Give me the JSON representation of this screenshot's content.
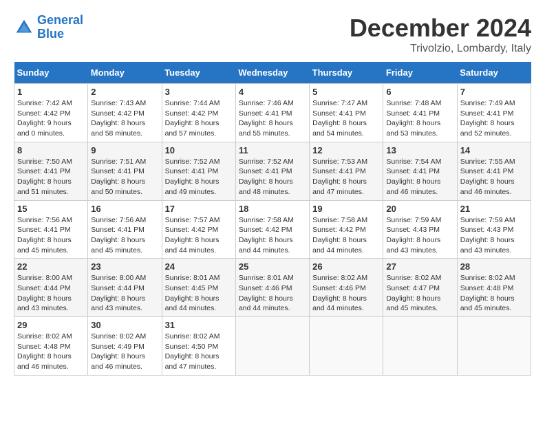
{
  "header": {
    "logo_line1": "General",
    "logo_line2": "Blue",
    "month": "December 2024",
    "location": "Trivolzio, Lombardy, Italy"
  },
  "weekdays": [
    "Sunday",
    "Monday",
    "Tuesday",
    "Wednesday",
    "Thursday",
    "Friday",
    "Saturday"
  ],
  "weeks": [
    [
      {
        "day": "1",
        "info": "Sunrise: 7:42 AM\nSunset: 4:42 PM\nDaylight: 9 hours\nand 0 minutes."
      },
      {
        "day": "2",
        "info": "Sunrise: 7:43 AM\nSunset: 4:42 PM\nDaylight: 8 hours\nand 58 minutes."
      },
      {
        "day": "3",
        "info": "Sunrise: 7:44 AM\nSunset: 4:42 PM\nDaylight: 8 hours\nand 57 minutes."
      },
      {
        "day": "4",
        "info": "Sunrise: 7:46 AM\nSunset: 4:41 PM\nDaylight: 8 hours\nand 55 minutes."
      },
      {
        "day": "5",
        "info": "Sunrise: 7:47 AM\nSunset: 4:41 PM\nDaylight: 8 hours\nand 54 minutes."
      },
      {
        "day": "6",
        "info": "Sunrise: 7:48 AM\nSunset: 4:41 PM\nDaylight: 8 hours\nand 53 minutes."
      },
      {
        "day": "7",
        "info": "Sunrise: 7:49 AM\nSunset: 4:41 PM\nDaylight: 8 hours\nand 52 minutes."
      }
    ],
    [
      {
        "day": "8",
        "info": "Sunrise: 7:50 AM\nSunset: 4:41 PM\nDaylight: 8 hours\nand 51 minutes."
      },
      {
        "day": "9",
        "info": "Sunrise: 7:51 AM\nSunset: 4:41 PM\nDaylight: 8 hours\nand 50 minutes."
      },
      {
        "day": "10",
        "info": "Sunrise: 7:52 AM\nSunset: 4:41 PM\nDaylight: 8 hours\nand 49 minutes."
      },
      {
        "day": "11",
        "info": "Sunrise: 7:52 AM\nSunset: 4:41 PM\nDaylight: 8 hours\nand 48 minutes."
      },
      {
        "day": "12",
        "info": "Sunrise: 7:53 AM\nSunset: 4:41 PM\nDaylight: 8 hours\nand 47 minutes."
      },
      {
        "day": "13",
        "info": "Sunrise: 7:54 AM\nSunset: 4:41 PM\nDaylight: 8 hours\nand 46 minutes."
      },
      {
        "day": "14",
        "info": "Sunrise: 7:55 AM\nSunset: 4:41 PM\nDaylight: 8 hours\nand 46 minutes."
      }
    ],
    [
      {
        "day": "15",
        "info": "Sunrise: 7:56 AM\nSunset: 4:41 PM\nDaylight: 8 hours\nand 45 minutes."
      },
      {
        "day": "16",
        "info": "Sunrise: 7:56 AM\nSunset: 4:41 PM\nDaylight: 8 hours\nand 45 minutes."
      },
      {
        "day": "17",
        "info": "Sunrise: 7:57 AM\nSunset: 4:42 PM\nDaylight: 8 hours\nand 44 minutes."
      },
      {
        "day": "18",
        "info": "Sunrise: 7:58 AM\nSunset: 4:42 PM\nDaylight: 8 hours\nand 44 minutes."
      },
      {
        "day": "19",
        "info": "Sunrise: 7:58 AM\nSunset: 4:42 PM\nDaylight: 8 hours\nand 44 minutes."
      },
      {
        "day": "20",
        "info": "Sunrise: 7:59 AM\nSunset: 4:43 PM\nDaylight: 8 hours\nand 43 minutes."
      },
      {
        "day": "21",
        "info": "Sunrise: 7:59 AM\nSunset: 4:43 PM\nDaylight: 8 hours\nand 43 minutes."
      }
    ],
    [
      {
        "day": "22",
        "info": "Sunrise: 8:00 AM\nSunset: 4:44 PM\nDaylight: 8 hours\nand 43 minutes."
      },
      {
        "day": "23",
        "info": "Sunrise: 8:00 AM\nSunset: 4:44 PM\nDaylight: 8 hours\nand 43 minutes."
      },
      {
        "day": "24",
        "info": "Sunrise: 8:01 AM\nSunset: 4:45 PM\nDaylight: 8 hours\nand 44 minutes."
      },
      {
        "day": "25",
        "info": "Sunrise: 8:01 AM\nSunset: 4:46 PM\nDaylight: 8 hours\nand 44 minutes."
      },
      {
        "day": "26",
        "info": "Sunrise: 8:02 AM\nSunset: 4:46 PM\nDaylight: 8 hours\nand 44 minutes."
      },
      {
        "day": "27",
        "info": "Sunrise: 8:02 AM\nSunset: 4:47 PM\nDaylight: 8 hours\nand 45 minutes."
      },
      {
        "day": "28",
        "info": "Sunrise: 8:02 AM\nSunset: 4:48 PM\nDaylight: 8 hours\nand 45 minutes."
      }
    ],
    [
      {
        "day": "29",
        "info": "Sunrise: 8:02 AM\nSunset: 4:48 PM\nDaylight: 8 hours\nand 46 minutes."
      },
      {
        "day": "30",
        "info": "Sunrise: 8:02 AM\nSunset: 4:49 PM\nDaylight: 8 hours\nand 46 minutes."
      },
      {
        "day": "31",
        "info": "Sunrise: 8:02 AM\nSunset: 4:50 PM\nDaylight: 8 hours\nand 47 minutes."
      },
      {
        "day": "",
        "info": ""
      },
      {
        "day": "",
        "info": ""
      },
      {
        "day": "",
        "info": ""
      },
      {
        "day": "",
        "info": ""
      }
    ]
  ]
}
